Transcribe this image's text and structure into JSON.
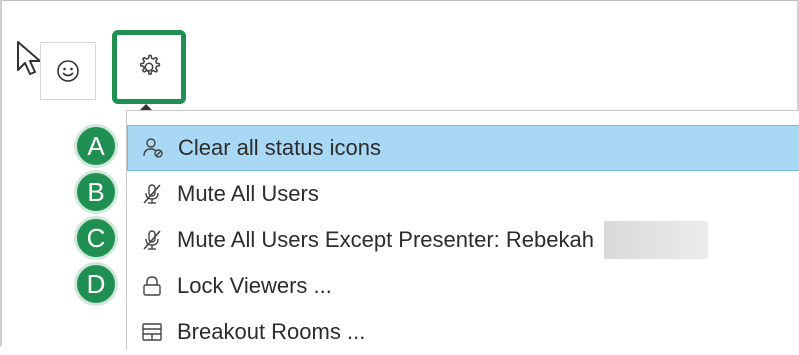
{
  "menu": {
    "items": [
      {
        "label": "Clear all status icons",
        "icon": "user-clear-icon",
        "highlighted": true
      },
      {
        "label": "Mute All Users",
        "icon": "mic-off-icon",
        "highlighted": false
      },
      {
        "label": "Mute All Users Except Presenter: Rebekah",
        "icon": "mic-off-icon",
        "highlighted": false
      },
      {
        "label": "Lock Viewers ...",
        "icon": "lock-icon",
        "highlighted": false
      },
      {
        "label": "Breakout Rooms ...",
        "icon": "breakout-rooms-icon",
        "highlighted": false
      }
    ]
  },
  "badges": [
    "A",
    "B",
    "C",
    "D"
  ],
  "colors": {
    "accent_green": "#1f8f52",
    "highlight_blue": "#a9d8f5",
    "highlight_border": "#79b9e6"
  }
}
